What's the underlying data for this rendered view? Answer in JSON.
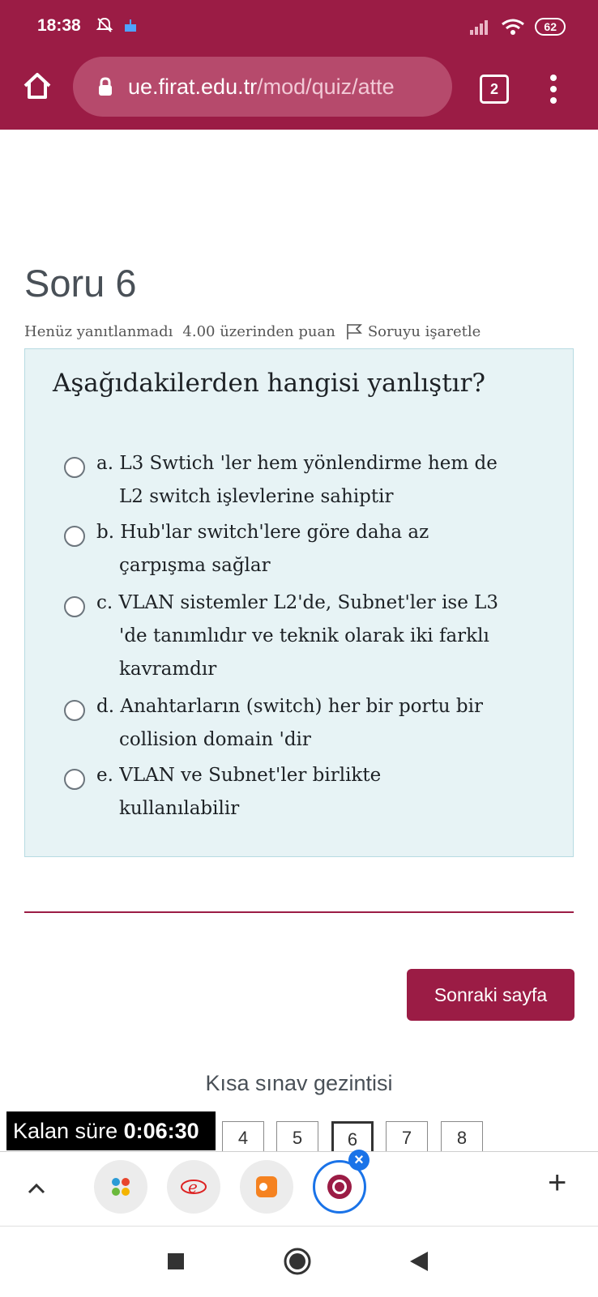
{
  "status_bar": {
    "time": "18:38",
    "battery": "62"
  },
  "browser": {
    "url_host": "ue.firat.edu.tr",
    "url_path": "/mod/quiz/atte",
    "tab_count": "2"
  },
  "question": {
    "title": "Soru 6",
    "status": "Henüz yanıtlanmadı",
    "points": "4.00 üzerinden puan",
    "flag_label": "Soruyu işaretle",
    "text": "Aşağıdakilerden hangisi yanlıştır?",
    "answers": [
      {
        "line1": "a. L3 Swtich 'ler hem yönlendirme hem de",
        "line2": "L2 switch işlevlerine sahiptir",
        "line3": ""
      },
      {
        "line1": "b. Hub'lar switch'lere göre daha az",
        "line2": "çarpışma sağlar",
        "line3": ""
      },
      {
        "line1": "c. VLAN sistemler L2'de, Subnet'ler ise L3",
        "line2": "'de tanımlıdır ve teknik olarak iki farklı",
        "line3": "kavramdır"
      },
      {
        "line1": "d. Anahtarların (switch) her bir portu bir",
        "line2": "collision domain 'dir",
        "line3": ""
      },
      {
        "line1": "e. VLAN ve Subnet'ler birlikte",
        "line2": "kullanılabilir",
        "line3": ""
      }
    ]
  },
  "next_button": "Sonraki sayfa",
  "quiz_nav": {
    "title": "Kısa sınav gezintisi",
    "timer_label": "Kalan süre",
    "timer_value": "0:06:30",
    "pages": [
      "4",
      "5",
      "6",
      "7",
      "8"
    ],
    "current_page": "6"
  },
  "colors": {
    "brand": "#9b1c45",
    "question_bg": "#e7f3f5",
    "active_tab": "#1a73e8"
  }
}
